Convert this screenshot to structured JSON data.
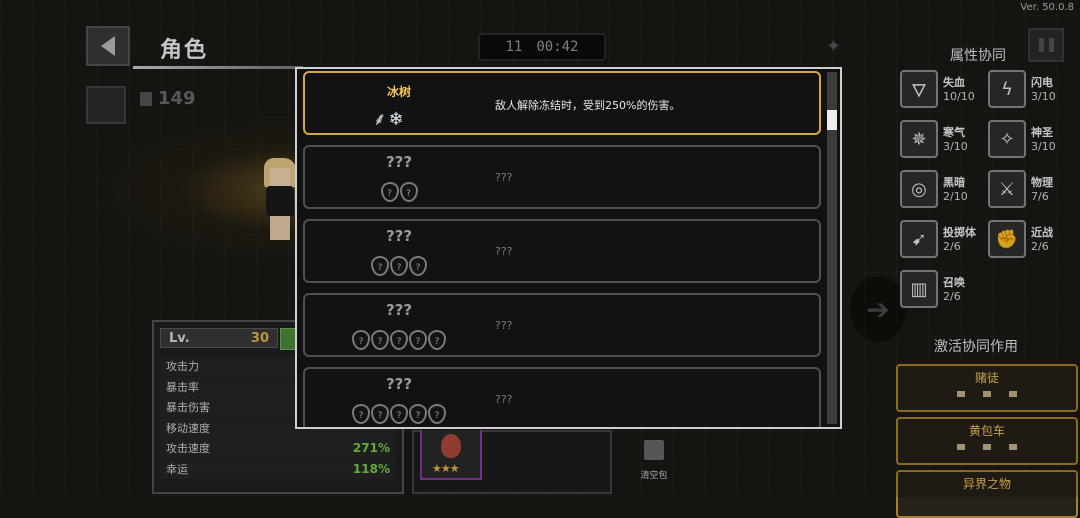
{
  "version": "Ver. 50.0.8",
  "header": {
    "title": "角色",
    "gold": "149"
  },
  "timer": {
    "level": "11",
    "time": "00:42"
  },
  "stats": {
    "lv_label": "Lv.",
    "lv_value": "30",
    "rows": [
      {
        "label": "攻击力",
        "value": ""
      },
      {
        "label": "暴击率",
        "value": ""
      },
      {
        "label": "暴击伤害",
        "value": ""
      },
      {
        "label": "移动速度",
        "value": ""
      },
      {
        "label": "攻击速度",
        "value": "271%"
      },
      {
        "label": "幸运",
        "value": "118%"
      }
    ]
  },
  "bag": {
    "clear_label": "清空包",
    "item_stars": "★★★"
  },
  "synergy": {
    "title": "属性协同",
    "items": [
      {
        "name": "失血",
        "count": "10/10",
        "icon": "blood-drop-icon"
      },
      {
        "name": "闪电",
        "count": "3/10",
        "icon": "lightning-icon"
      },
      {
        "name": "寒气",
        "count": "3/10",
        "icon": "snowflake-icon"
      },
      {
        "name": "神圣",
        "count": "3/10",
        "icon": "holy-icon"
      },
      {
        "name": "黑暗",
        "count": "2/10",
        "icon": "dark-swirl-icon"
      },
      {
        "name": "物理",
        "count": "7/6",
        "icon": "sword-icon"
      },
      {
        "name": "投掷体",
        "count": "2/6",
        "icon": "projectile-icon"
      },
      {
        "name": "近战",
        "count": "2/6",
        "icon": "fist-icon"
      },
      {
        "name": "召唤",
        "count": "2/6",
        "icon": "book-icon"
      }
    ]
  },
  "active": {
    "title": "激活协同作用",
    "cards": [
      {
        "name": "赌徒"
      },
      {
        "name": "黄包车"
      },
      {
        "name": "异界之物"
      }
    ]
  },
  "modal": {
    "rows": [
      {
        "name": "冰树",
        "desc": "敌人解除冻结时，受到250%的伤害。",
        "glyph": "⸙❄",
        "known": true,
        "icons": []
      },
      {
        "name": "???",
        "desc": "???",
        "known": false,
        "icons": [
          "?",
          "?"
        ]
      },
      {
        "name": "???",
        "desc": "???",
        "known": false,
        "icons": [
          "?",
          "?",
          "?"
        ]
      },
      {
        "name": "???",
        "desc": "???",
        "known": false,
        "icons": [
          "?",
          "?",
          "?",
          "?",
          "?"
        ]
      },
      {
        "name": "???",
        "desc": "???",
        "known": false,
        "icons": [
          "?",
          "?",
          "?",
          "?",
          "?"
        ]
      }
    ]
  }
}
